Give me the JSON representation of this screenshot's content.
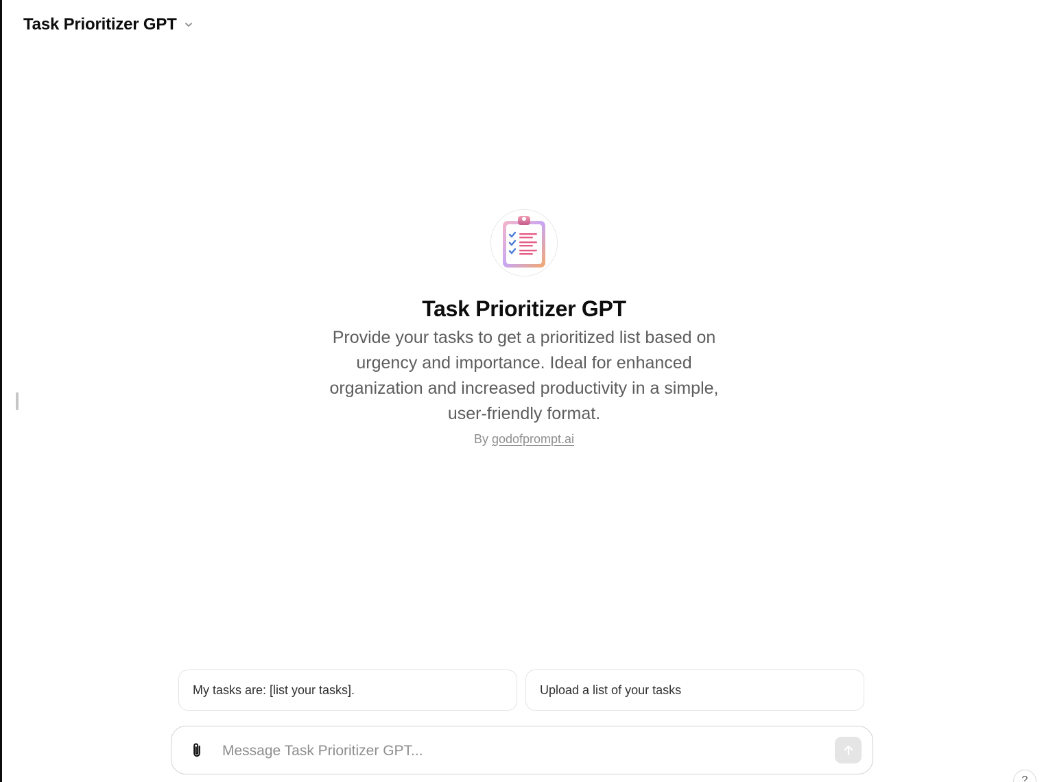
{
  "header": {
    "model_name": "Task Prioritizer GPT",
    "dropdown_icon": "chevron-down-icon"
  },
  "hero": {
    "avatar_icon": "clipboard-checklist-icon",
    "title": "Task Prioritizer GPT",
    "description": "Provide your tasks to get a prioritized list based on urgency and importance. Ideal for enhanced organization and increased productivity in a simple, user-friendly format.",
    "author_prefix": "By",
    "author_link": "godofprompt.ai"
  },
  "conversation_starters": [
    {
      "label": "My tasks are: [list your tasks]."
    },
    {
      "label": "Upload a list of your tasks"
    }
  ],
  "composer": {
    "placeholder": "Message Task Prioritizer GPT...",
    "value": "",
    "attach_icon": "paperclip-icon",
    "send_icon": "arrow-up-icon"
  },
  "help": {
    "label": "?"
  },
  "colors": {
    "text_primary": "#0d0d0d",
    "text_secondary": "#5d5d5d",
    "text_muted": "#8f8f8f",
    "border": "#e3e3e3",
    "send_disabled_bg": "#e5e5e5"
  }
}
